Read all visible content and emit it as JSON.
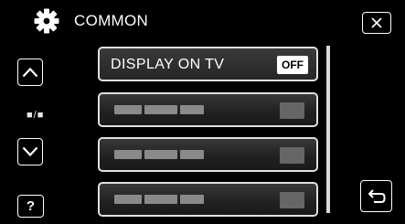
{
  "header": {
    "title": "COMMON",
    "icon": "gear-icon"
  },
  "side": {
    "up_icon": "chevron-up-icon",
    "page_indicator": "■/■",
    "down_icon": "chevron-down-icon",
    "help_label": "?"
  },
  "menu": {
    "items": [
      {
        "label": "DISPLAY ON TV",
        "value": "OFF"
      }
    ]
  },
  "colors": {
    "background": "#000000",
    "foreground": "#ffffff"
  }
}
